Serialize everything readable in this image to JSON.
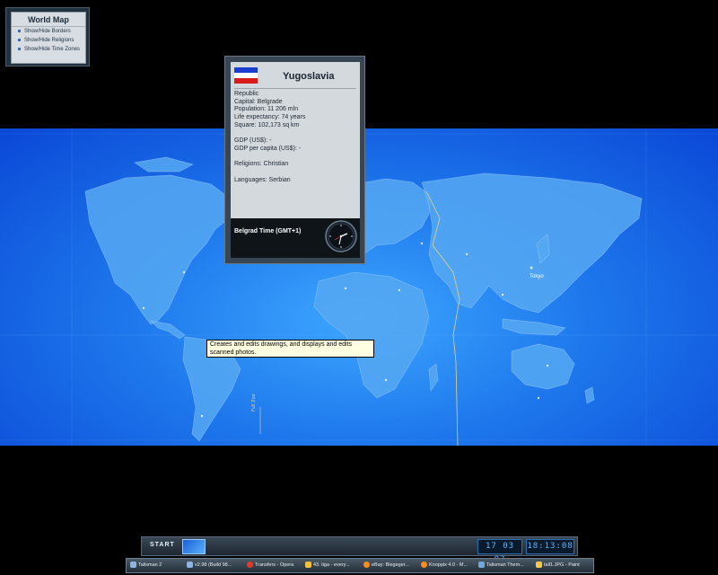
{
  "widget": {
    "title": "World Map",
    "items": [
      "Show/Hide Borders",
      "Show/Hide Religions",
      "Show/Hide Time Zones"
    ]
  },
  "country": {
    "name": "Yugoslavia",
    "flag_colors": [
      "#1a3fd0",
      "#ffffff",
      "#d81c1c"
    ],
    "facts": [
      "Republic",
      "Capital:  Belgrade",
      "Population: 11 206 mln",
      "Life expectancy: 74 years",
      "Square: 102,173 sq km",
      "",
      "GDP (US$): -",
      "GDP per capita (US$): -",
      "",
      "Religions: Christian",
      "",
      "Languages: Serbian"
    ],
    "local_time_label": "Belgrad Time (GMT+1)"
  },
  "map": {
    "city_label": "Tokyo",
    "side_label": "Full Zoo"
  },
  "tooltip": "Creates and edits drawings, and displays and edits scanned photos.",
  "dock": {
    "start_label": "START",
    "date": "17 03 07",
    "time": "18:13:08"
  },
  "taskbar": [
    {
      "label": "Talisman 2",
      "icon": "folder-icon",
      "color": "#8fb4e0"
    },
    {
      "label": "v2.98 (Build 98...",
      "icon": "folder-icon",
      "color": "#8fb4e0"
    },
    {
      "label": "Transfers - Opera",
      "icon": "opera-icon",
      "color": "#e23b2b"
    },
    {
      "label": "43. tiga - every...",
      "icon": "music-icon",
      "color": "#f0c040"
    },
    {
      "label": "eBay: Biegeger...",
      "icon": "firefox-icon",
      "color": "#ff8c1a"
    },
    {
      "label": "Knoppix 4.0 - M...",
      "icon": "firefox-icon",
      "color": "#ff8c1a"
    },
    {
      "label": "Talisman Them...",
      "icon": "window-icon",
      "color": "#6fa8dc"
    },
    {
      "label": "tall1.JPG - Paint",
      "icon": "paint-icon",
      "color": "#f2c94c"
    }
  ]
}
